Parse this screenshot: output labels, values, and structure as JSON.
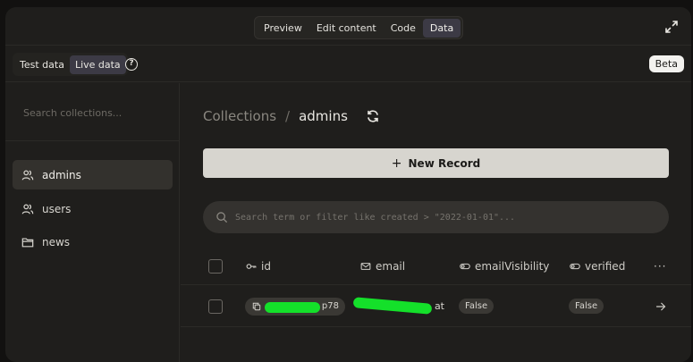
{
  "topbar": {
    "tabs": [
      {
        "label": "Preview",
        "active": false
      },
      {
        "label": "Edit content",
        "active": false
      },
      {
        "label": "Code",
        "active": false
      },
      {
        "label": "Data",
        "active": true
      }
    ],
    "expand_icon": "expand-icon"
  },
  "subbar": {
    "test_label": "Test data",
    "live_label": "Live data",
    "active_mode": "Live data",
    "help_icon": "question-circle-icon",
    "beta_label": "Beta"
  },
  "sidebar": {
    "search_placeholder": "Search collections...",
    "items": [
      {
        "label": "admins",
        "icon": "users-icon",
        "active": true
      },
      {
        "label": "users",
        "icon": "users-icon",
        "active": false
      },
      {
        "label": "news",
        "icon": "folder-icon",
        "active": false
      }
    ]
  },
  "main": {
    "breadcrumb_root": "Collections",
    "breadcrumb_sep": "/",
    "breadcrumb_current": "admins",
    "new_record_label": "New Record",
    "search_placeholder": "Search term or filter like created > \"2022-01-01\"...",
    "columns": {
      "id": "id",
      "email": "email",
      "email_visibility": "emailVisibility",
      "verified": "verified",
      "more": "···"
    },
    "rows": [
      {
        "id_visible_suffix": "p78",
        "email_visible_suffix": "at",
        "email_visibility": "False",
        "verified": "False"
      }
    ]
  },
  "colors": {
    "background": "#1f1e1c",
    "accent_tab": "#3c3a45",
    "button_bg": "#d7d5cf",
    "redaction": "#14e02a"
  }
}
